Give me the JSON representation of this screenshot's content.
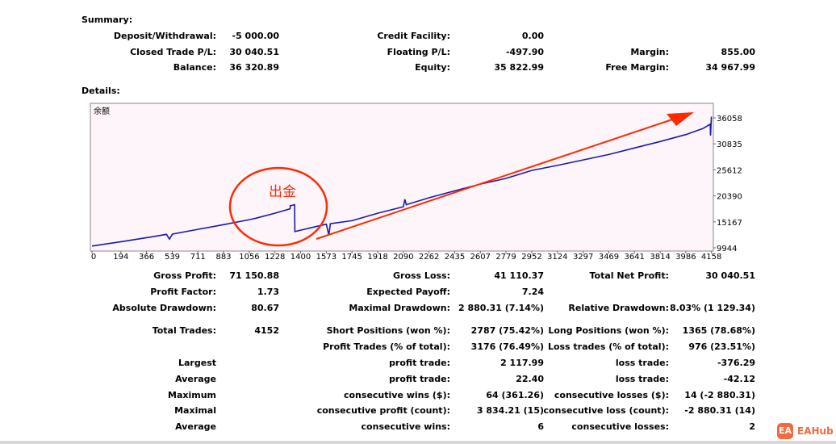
{
  "summary": {
    "heading": "Summary:",
    "deposit_label": "Deposit/Withdrawal:",
    "deposit_value": "-5 000.00",
    "closed_label": "Closed Trade P/L:",
    "closed_value": "30 040.51",
    "balance_label": "Balance:",
    "balance_value": "36 320.89",
    "credit_label": "Credit Facility:",
    "credit_value": "0.00",
    "floating_label": "Floating P/L:",
    "floating_value": "-497.90",
    "equity_label": "Equity:",
    "equity_value": "35 822.99",
    "margin_label": "Margin:",
    "margin_value": "855.00",
    "free_margin_label": "Free Margin:",
    "free_margin_value": "34 967.99"
  },
  "details": {
    "heading": "Details:"
  },
  "chart_data": {
    "type": "line",
    "corner_label": "余额",
    "x_ticks": [
      "0",
      "194",
      "366",
      "539",
      "711",
      "883",
      "1056",
      "1228",
      "1400",
      "1573",
      "1745",
      "1918",
      "2090",
      "2262",
      "2435",
      "2607",
      "2779",
      "2952",
      "3124",
      "3297",
      "3469",
      "3641",
      "3814",
      "3986",
      "4158"
    ],
    "y_ticks": [
      "36058",
      "30835",
      "25612",
      "20390",
      "15167",
      "9944"
    ],
    "xlim": [
      0,
      4160
    ],
    "ylim": [
      9944,
      36058
    ],
    "series": [
      {
        "color": "#1a1aa6",
        "points": [
          [
            0,
            10300
          ],
          [
            200,
            11200
          ],
          [
            400,
            12150
          ],
          [
            500,
            12650
          ],
          [
            520,
            11700
          ],
          [
            540,
            12700
          ],
          [
            700,
            13600
          ],
          [
            900,
            14700
          ],
          [
            1056,
            15600
          ],
          [
            1100,
            15900
          ],
          [
            1228,
            16900
          ],
          [
            1330,
            17800
          ],
          [
            1331,
            18400
          ],
          [
            1360,
            18600
          ],
          [
            1362,
            13200
          ],
          [
            1400,
            13500
          ],
          [
            1573,
            14700
          ],
          [
            1590,
            12500
          ],
          [
            1600,
            14800
          ],
          [
            1745,
            15400
          ],
          [
            1918,
            16900
          ],
          [
            2090,
            18200
          ],
          [
            2100,
            19700
          ],
          [
            2110,
            18600
          ],
          [
            2262,
            20000
          ],
          [
            2435,
            21400
          ],
          [
            2600,
            22700
          ],
          [
            2779,
            23900
          ],
          [
            2952,
            25500
          ],
          [
            3124,
            26500
          ],
          [
            3297,
            27600
          ],
          [
            3469,
            28700
          ],
          [
            3641,
            30000
          ],
          [
            3814,
            31300
          ],
          [
            3986,
            32700
          ],
          [
            4100,
            33900
          ],
          [
            4150,
            34800
          ],
          [
            4152,
            32500
          ],
          [
            4158,
            36300
          ]
        ]
      }
    ],
    "annotations": [
      {
        "text": "出金",
        "color": "#ff2a00"
      }
    ]
  },
  "stats": {
    "gross_profit_label": "Gross Profit:",
    "gross_profit_value": "71 150.88",
    "gross_loss_label": "Gross Loss:",
    "gross_loss_value": "41 110.37",
    "total_net_label": "Total Net Profit:",
    "total_net_value": "30 040.51",
    "profit_factor_label": "Profit Factor:",
    "profit_factor_value": "1.73",
    "expected_payoff_label": "Expected Payoff:",
    "expected_payoff_value": "7.24",
    "abs_dd_label": "Absolute Drawdown:",
    "abs_dd_value": "80.67",
    "max_dd_label": "Maximal Drawdown:",
    "max_dd_value": "2 880.31 (7.14%)",
    "rel_dd_label": "Relative Drawdown:",
    "rel_dd_value": "8.03% (1 129.34)",
    "total_trades_label": "Total Trades:",
    "total_trades_value": "4152",
    "short_label": "Short Positions (won %):",
    "short_value": "2787 (75.42%)",
    "long_label": "Long Positions (won %):",
    "long_value": "1365 (78.68%)",
    "profit_trades_label": "Profit Trades (% of total):",
    "profit_trades_value": "3176 (76.49%)",
    "loss_trades_label": "Loss trades (% of total):",
    "loss_trades_value": "976 (23.51%)",
    "largest_label": "Largest",
    "largest_profit_label": "profit trade:",
    "largest_profit_value": "2 117.99",
    "largest_loss_label": "loss trade:",
    "largest_loss_value": "-376.29",
    "average_label": "Average",
    "average_profit_label": "profit trade:",
    "average_profit_value": "22.40",
    "average_loss_label": "loss trade:",
    "average_loss_value": "-42.12",
    "maximum_label": "Maximum",
    "max_cons_wins_label": "consecutive wins ($):",
    "max_cons_wins_value": "64 (361.26)",
    "max_cons_losses_label": "consecutive losses ($):",
    "max_cons_losses_value": "14 (-2 880.31)",
    "maximal_label": "Maximal",
    "maximal_profit_label": "consecutive profit (count):",
    "maximal_profit_value": "3 834.21 (15)",
    "maximal_loss_label": "consecutive loss (count):",
    "maximal_loss_value": "-2 880.31 (14)",
    "average2_label": "Average",
    "avg_cons_wins_label": "consecutive wins:",
    "avg_cons_wins_value": "6",
    "avg_cons_losses_label": "consecutive losses:",
    "avg_cons_losses_value": "2"
  },
  "watermark": {
    "logo_text": "EA",
    "text": "EAHub"
  }
}
